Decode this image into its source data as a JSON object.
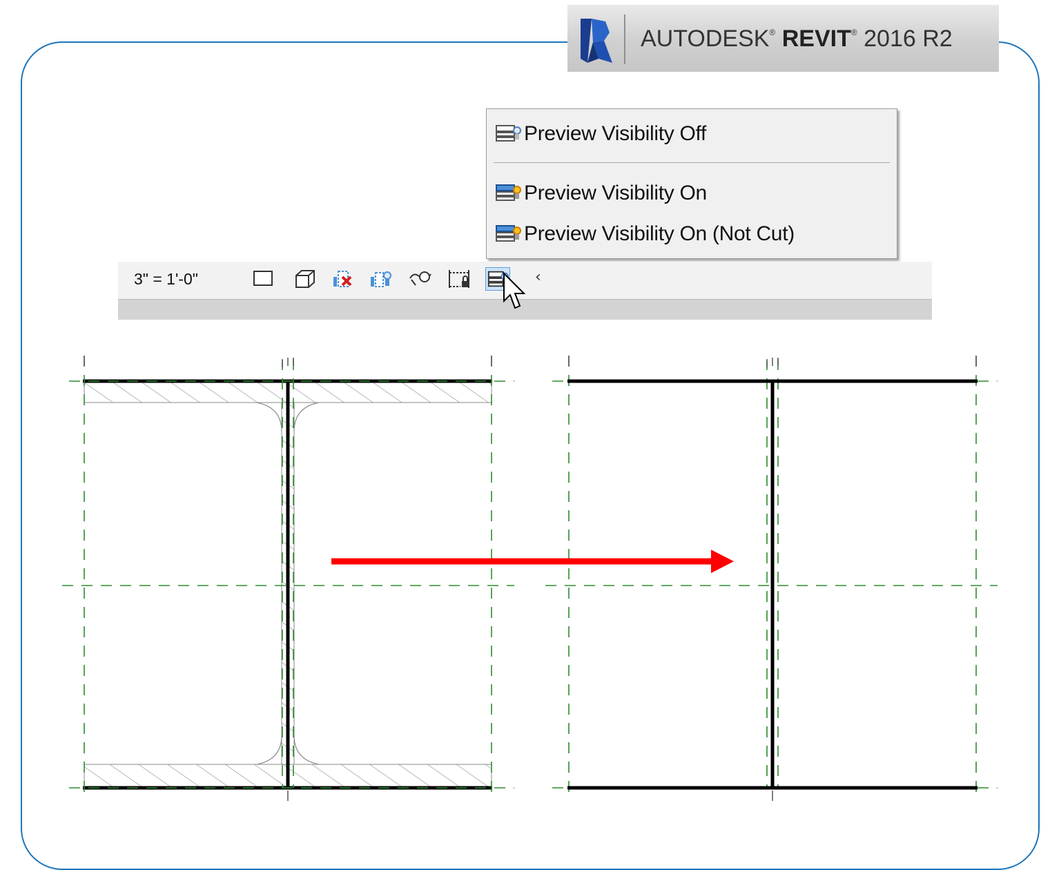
{
  "banner": {
    "brand": "AUTODESK",
    "product": "REVIT",
    "version": "2016 R2",
    "logo_icon": "revit-r-logo-icon"
  },
  "statusbar": {
    "scale": "3\" = 1'-0\"",
    "icons": [
      "detail-level-icon",
      "visual-style-icon",
      "hide-isolate-icon",
      "reveal-hidden-icon",
      "shadows-icon",
      "crop-lock-icon",
      "preview-visibility-icon",
      "collapse-chevron-icon"
    ]
  },
  "dropdown": {
    "items": [
      {
        "label": "Preview Visibility Off",
        "icon": "preview-visibility-off-icon"
      },
      {
        "label": "Preview Visibility On",
        "icon": "preview-visibility-on-icon"
      },
      {
        "label": "Preview Visibility On (Not Cut)",
        "icon": "preview-visibility-on-notcut-icon"
      }
    ]
  },
  "colors": {
    "frame": "#1c75bc",
    "arrow": "#ff0000",
    "reference_lines": "#2e8b2e",
    "beam": "#000000",
    "hatch": "#909090"
  },
  "drawing": {
    "left_view": "beam section with cut hatch and fillets",
    "right_view": "beam section as single lines (not cut)"
  }
}
